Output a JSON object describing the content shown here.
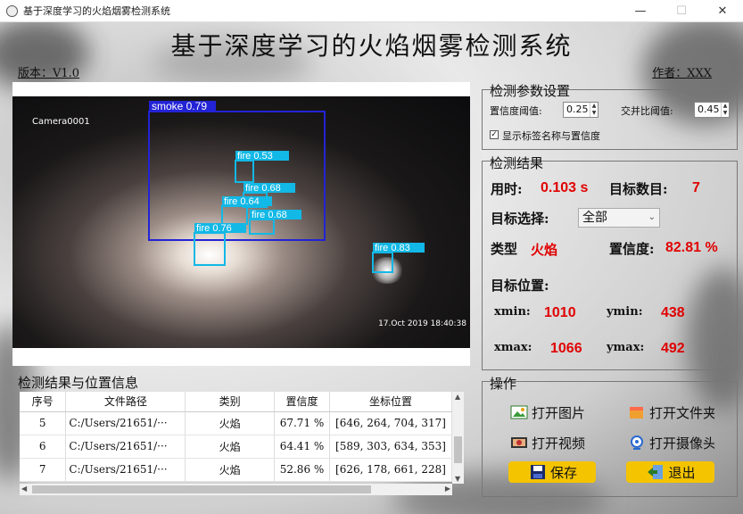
{
  "window": {
    "title": "基于深度学习的火焰烟雾检测系统",
    "controls": [
      "—",
      "☐",
      "✕"
    ]
  },
  "header": {
    "title": "基于深度学习的火焰烟雾检测系统",
    "version": "版本：V1.0",
    "author": "作者：XXX"
  },
  "video": {
    "camera_label": "Camera0001",
    "timestamp": "17.Oct 2019   18:40:38",
    "detections": [
      {
        "label": "smoke 0.79",
        "class": "smoke"
      },
      {
        "label": "fire 0.53",
        "class": "fire"
      },
      {
        "label": "fire 0.68",
        "class": "fire"
      },
      {
        "label": "fire 0.64",
        "class": "fire"
      },
      {
        "label": "fire 0.68",
        "class": "fire"
      },
      {
        "label": "fire 0.76",
        "class": "fire"
      },
      {
        "label": "fire 0.83",
        "class": "fire"
      }
    ],
    "colors": {
      "smoke_box": "#2323d6",
      "fire_box": "#12b8e6"
    }
  },
  "params": {
    "title": "检测参数设置",
    "conf_label": "置信度阈值:",
    "conf_value": "0.25",
    "iou_label": "交并比阈值:",
    "iou_value": "0.45",
    "show_labels_text": "显示标签名称与置信度",
    "show_labels_checked": "✓"
  },
  "results": {
    "title": "检测结果",
    "time_label": "用时:",
    "time_value": "0.103 s",
    "count_label": "目标数目:",
    "count_value": "7",
    "select_label": "目标选择:",
    "select_value": "全部",
    "type_label": "类型",
    "type_value": "火焰",
    "conf_label": "置信度:",
    "conf_value": "82.81 %",
    "pos_label": "目标位置:",
    "xmin_label": "xmin:",
    "xmin_value": "1010",
    "ymin_label": "ymin:",
    "ymin_value": "438",
    "xmax_label": "xmax:",
    "xmax_value": "1066",
    "ymax_label": "ymax:",
    "ymax_value": "492",
    "accent": "#e00000"
  },
  "ops": {
    "title": "操作",
    "open_image": "打开图片",
    "open_folder": "打开文件夹",
    "open_video": "打开视频",
    "open_camera": "打开摄像头",
    "save": "保存",
    "exit": "退出",
    "accent": "#f4c400"
  },
  "table": {
    "title": "检测结果与位置信息",
    "headers": [
      "序号",
      "文件路径",
      "类别",
      "置信度",
      "坐标位置"
    ],
    "rows": [
      [
        "5",
        "C:/Users/21651/···",
        "火焰",
        "67.71 %",
        "[646, 264, 704, 317]"
      ],
      [
        "6",
        "C:/Users/21651/···",
        "火焰",
        "64.41 %",
        "[589, 303, 634, 353]"
      ],
      [
        "7",
        "C:/Users/21651/···",
        "火焰",
        "52.86 %",
        "[626, 178, 661, 228]"
      ]
    ]
  }
}
